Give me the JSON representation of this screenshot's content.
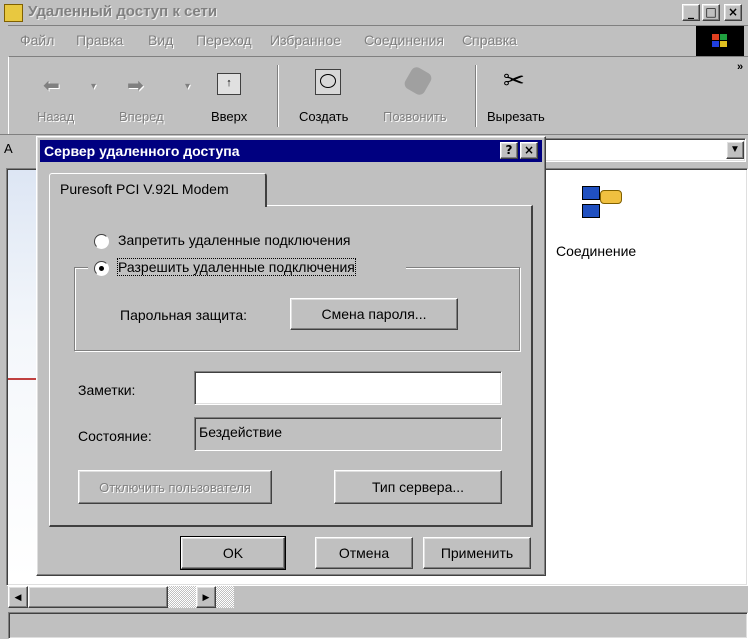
{
  "main_window": {
    "title": "Удаленный доступ к сети",
    "menu": [
      "Файл",
      "Правка",
      "Вид",
      "Переход",
      "Избранное",
      "Соединения",
      "Справка"
    ],
    "toolbar": {
      "back": "Назад",
      "forward": "Вперед",
      "up": "Вверх",
      "create": "Создать",
      "dial": "Позвонить",
      "cut": "Вырезать"
    },
    "address_fragment": "А",
    "connection_icon_label": "Соединение"
  },
  "dialog": {
    "title": "Сервер удаленного доступа",
    "help_glyph": "?",
    "close_glyph": "×",
    "tab_label": "Puresoft PCI V.92L Modem",
    "radio_deny": "Запретить удаленные подключения",
    "radio_allow": "Разрешить удаленные подключения",
    "password_label": "Парольная защита:",
    "change_password_button": "Смена пароля...",
    "notes_label": "Заметки:",
    "notes_value": "",
    "status_label": "Состояние:",
    "status_value": "Бездействие",
    "disconnect_button": "Отключить пользователя",
    "server_type_button": "Тип сервера...",
    "ok_button": "OK",
    "cancel_button": "Отмена",
    "apply_button": "Применить"
  },
  "colors": {
    "active_title": "#000080",
    "inactive_title": "#808080",
    "face": "#c0c0c0"
  }
}
